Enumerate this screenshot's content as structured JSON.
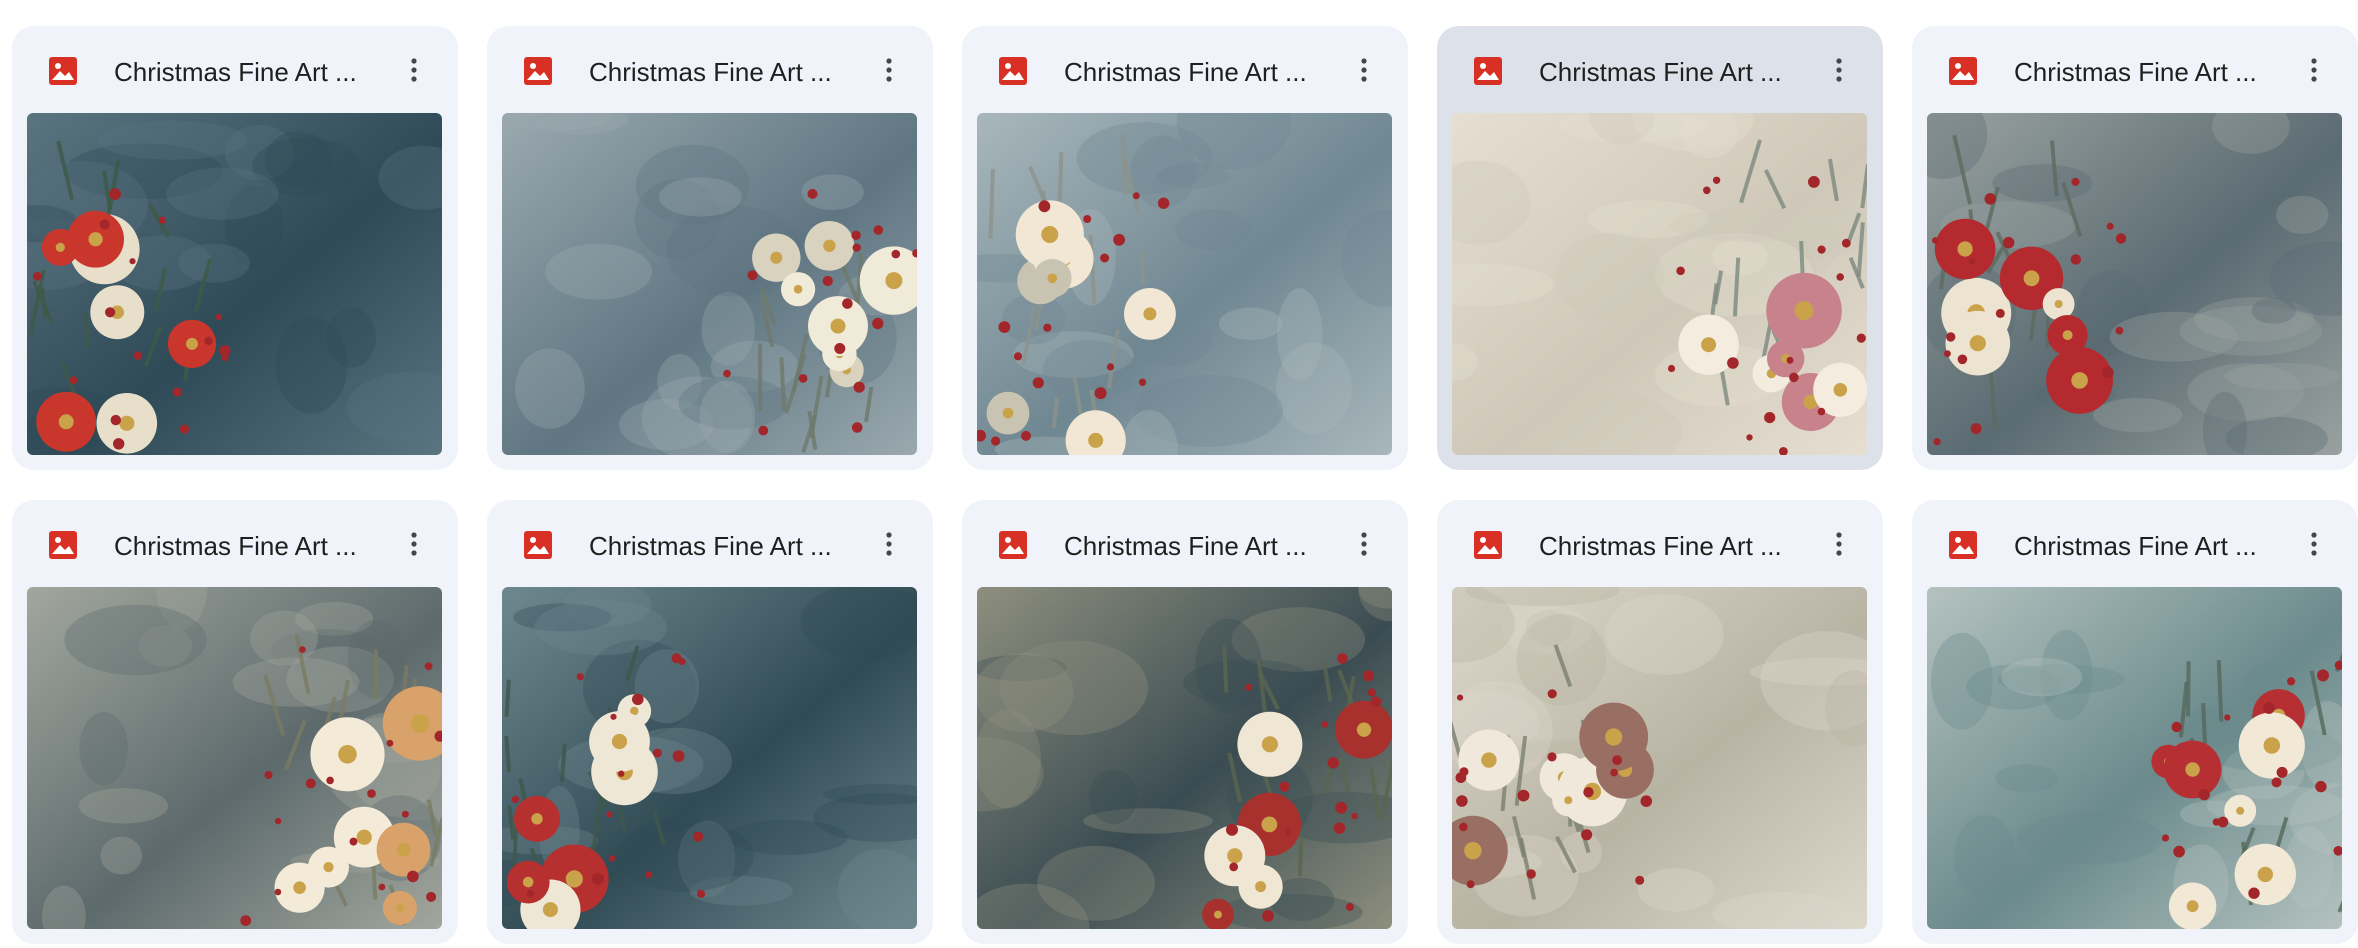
{
  "files": [
    {
      "name": "Christmas Fine Art ...",
      "icon": "image-file-icon",
      "selected": false,
      "palette": {
        "bg": "#2f4a57",
        "light": "#5a7480",
        "flower": "#c9362c",
        "cream": "#e8dfcb",
        "leaf": "#3f5a45"
      }
    },
    {
      "name": "Christmas Fine Art ...",
      "icon": "image-file-icon",
      "selected": false,
      "palette": {
        "bg": "#5f7682",
        "light": "#9aa9ae",
        "flower": "#f0ead9",
        "cream": "#d9d2bf",
        "leaf": "#6f7a6c"
      }
    },
    {
      "name": "Christmas Fine Art ...",
      "icon": "image-file-icon",
      "selected": false,
      "palette": {
        "bg": "#6f8792",
        "light": "#a8b7bb",
        "flower": "#f1e7d4",
        "cream": "#c9c3b2",
        "leaf": "#8c938c"
      }
    },
    {
      "name": "Christmas Fine Art ...",
      "icon": "image-file-icon",
      "selected": true,
      "palette": {
        "bg": "#cfc8b9",
        "light": "#e6dfd1",
        "flower": "#f3ecdf",
        "cream": "#c8828c",
        "leaf": "#7d8a7f"
      }
    },
    {
      "name": "Christmas Fine Art ...",
      "icon": "image-file-icon",
      "selected": false,
      "palette": {
        "bg": "#5a6b72",
        "light": "#9aa2a0",
        "flower": "#b52a2e",
        "cream": "#ece3d1",
        "leaf": "#5c6c60"
      }
    },
    {
      "name": "Christmas Fine Art ...",
      "icon": "image-file-icon",
      "selected": false,
      "palette": {
        "bg": "#5d6a6c",
        "light": "#a2a79e",
        "flower": "#f3ead7",
        "cream": "#d9a26a",
        "leaf": "#7a7c62"
      }
    },
    {
      "name": "Christmas Fine Art ...",
      "icon": "image-file-icon",
      "selected": false,
      "palette": {
        "bg": "#314b55",
        "light": "#6f8890",
        "flower": "#efe7d6",
        "cream": "#b5302f",
        "leaf": "#3f574b"
      }
    },
    {
      "name": "Christmas Fine Art ...",
      "icon": "image-file-icon",
      "selected": false,
      "palette": {
        "bg": "#3a4c52",
        "light": "#8e8f7e",
        "flower": "#efe6d3",
        "cream": "#a8302d",
        "leaf": "#5a664f"
      }
    },
    {
      "name": "Christmas Fine Art ...",
      "icon": "image-file-icon",
      "selected": false,
      "palette": {
        "bg": "#b8b4a4",
        "light": "#ddd8ca",
        "flower": "#efe8db",
        "cream": "#9a6f63",
        "leaf": "#7c806f"
      }
    },
    {
      "name": "Christmas Fine Art ...",
      "icon": "image-file-icon",
      "selected": false,
      "palette": {
        "bg": "#6b8a8c",
        "light": "#b4c2bf",
        "flower": "#f1e8d6",
        "cream": "#b62f33",
        "leaf": "#55695c"
      }
    }
  ],
  "more_icon": "more-vert-icon",
  "colors": {
    "card_bg": "#f0f4fa",
    "card_selected_bg": "#dde2ea",
    "image_icon_red": "#d93025",
    "title_text": "#1f1f1f"
  }
}
